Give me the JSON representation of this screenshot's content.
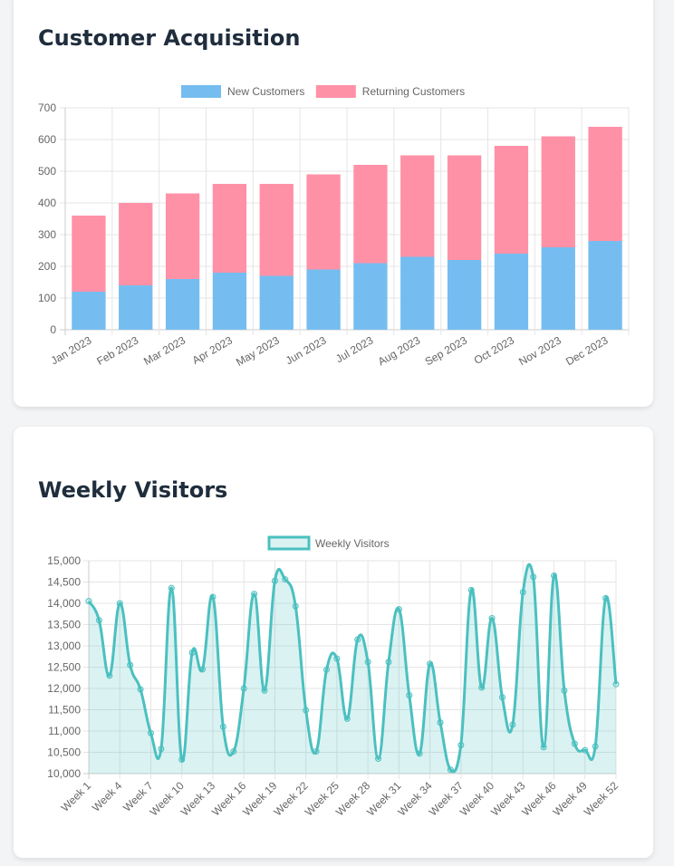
{
  "cards": [
    {
      "title": "Customer Acquisition"
    },
    {
      "title": "Weekly Visitors"
    }
  ],
  "chart_data": [
    {
      "type": "bar",
      "stacked": true,
      "title": "Customer Acquisition",
      "categories": [
        "Jan 2023",
        "Feb 2023",
        "Mar 2023",
        "Apr 2023",
        "May 2023",
        "Jun 2023",
        "Jul 2023",
        "Aug 2023",
        "Sep 2023",
        "Oct 2023",
        "Nov 2023",
        "Dec 2023"
      ],
      "series": [
        {
          "name": "New Customers",
          "color": "#75bdf0",
          "values": [
            120,
            140,
            160,
            180,
            170,
            190,
            210,
            230,
            220,
            240,
            260,
            280
          ]
        },
        {
          "name": "Returning Customers",
          "color": "#ff91a7",
          "values": [
            240,
            260,
            270,
            280,
            290,
            300,
            310,
            320,
            330,
            340,
            350,
            360
          ]
        }
      ],
      "ylim": [
        0,
        700
      ],
      "yticks": [
        0,
        100,
        200,
        300,
        400,
        500,
        600,
        700
      ],
      "grid": true,
      "legend": "top-center"
    },
    {
      "type": "area",
      "title": "Weekly Visitors",
      "x": [
        "Week 1",
        "Week 2",
        "Week 3",
        "Week 4",
        "Week 5",
        "Week 6",
        "Week 7",
        "Week 8",
        "Week 9",
        "Week 10",
        "Week 11",
        "Week 12",
        "Week 13",
        "Week 14",
        "Week 15",
        "Week 16",
        "Week 17",
        "Week 18",
        "Week 19",
        "Week 20",
        "Week 21",
        "Week 22",
        "Week 23",
        "Week 24",
        "Week 25",
        "Week 26",
        "Week 27",
        "Week 28",
        "Week 29",
        "Week 30",
        "Week 31",
        "Week 32",
        "Week 33",
        "Week 34",
        "Week 35",
        "Week 36",
        "Week 37",
        "Week 38",
        "Week 39",
        "Week 40",
        "Week 41",
        "Week 42",
        "Week 43",
        "Week 44",
        "Week 45",
        "Week 46",
        "Week 47",
        "Week 48",
        "Week 49",
        "Week 50",
        "Week 51",
        "Week 52"
      ],
      "tick_labels": [
        "Week 1",
        "Week 4",
        "Week 7",
        "Week 10",
        "Week 13",
        "Week 16",
        "Week 19",
        "Week 22",
        "Week 25",
        "Week 28",
        "Week 31",
        "Week 34",
        "Week 37",
        "Week 40",
        "Week 43",
        "Week 46",
        "Week 49",
        "Week 52"
      ],
      "series": [
        {
          "name": "Weekly Visitors",
          "color": "#4bc0c0",
          "fill": "rgba(75,192,192,0.2)",
          "values": [
            14050,
            13600,
            12300,
            14000,
            12550,
            11980,
            10950,
            10580,
            14360,
            10330,
            12840,
            12450,
            14150,
            11100,
            10520,
            12000,
            14220,
            11950,
            14530,
            14560,
            13930,
            11490,
            10520,
            12440,
            12700,
            11290,
            13150,
            12620,
            10350,
            12620,
            13860,
            11840,
            10470,
            12580,
            11200,
            10090,
            10670,
            14310,
            12020,
            13650,
            11790,
            11150,
            14260,
            14620,
            10620,
            14650,
            11950,
            10700,
            10550,
            10640,
            14120,
            12100
          ]
        }
      ],
      "ylim": [
        10000,
        15000
      ],
      "yticks": [
        "10,000",
        "10,500",
        "11,000",
        "11,500",
        "12,000",
        "12,500",
        "13,000",
        "13,500",
        "14,000",
        "14,500",
        "15,000"
      ],
      "grid": true,
      "legend": "top-center"
    }
  ]
}
